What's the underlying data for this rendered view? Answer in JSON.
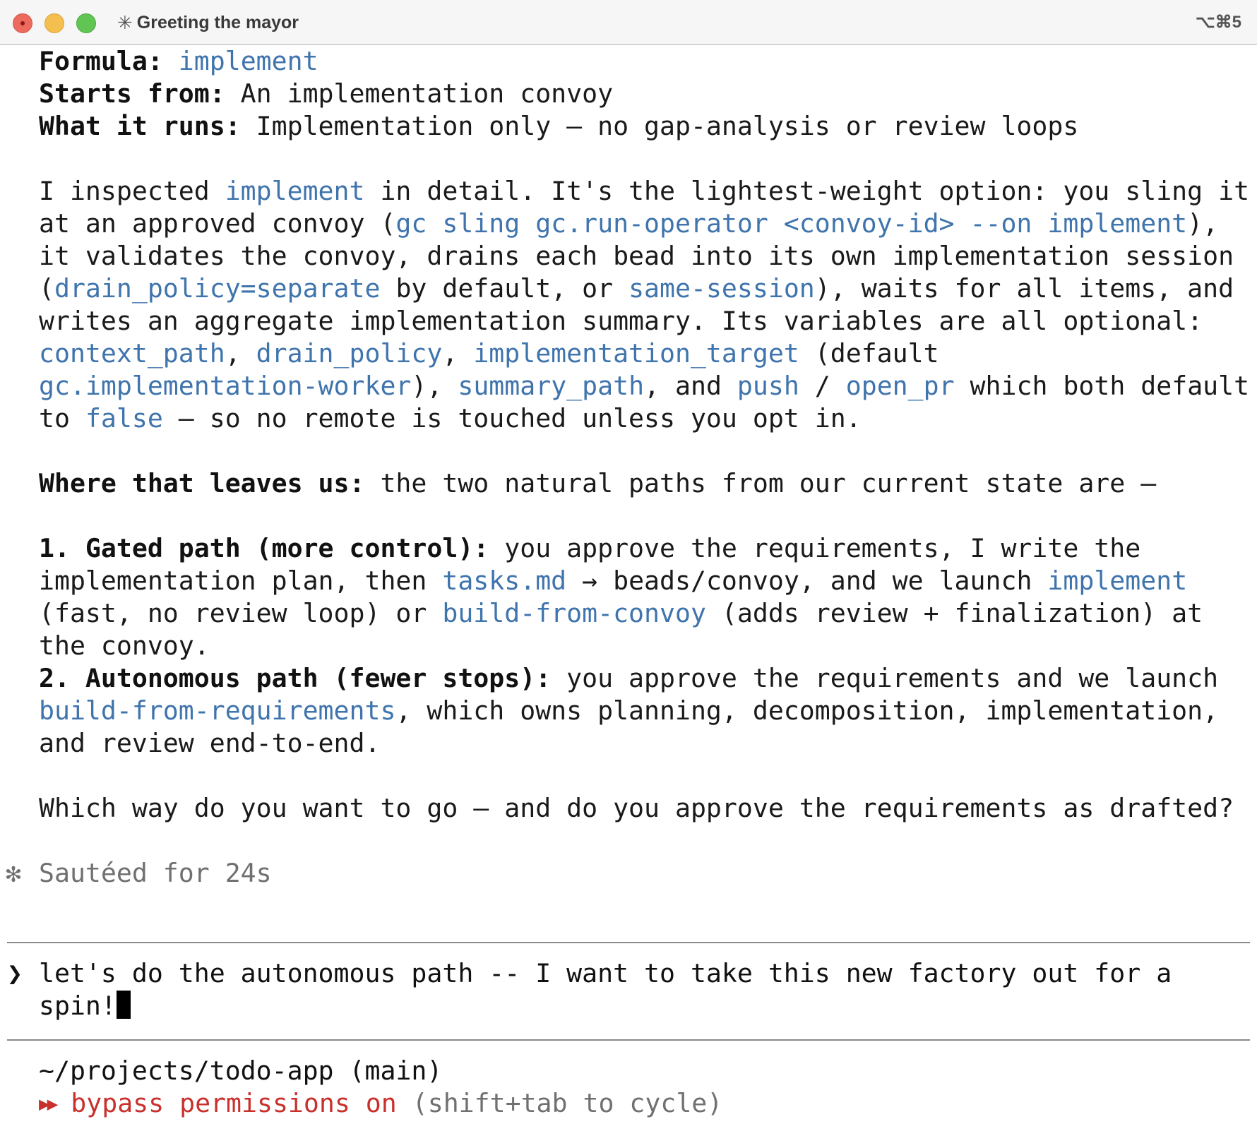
{
  "window": {
    "title": "Greeting the mayor",
    "title_icon": "✳",
    "shortcut": "⌥⌘5"
  },
  "formula": {
    "label": "Formula:",
    "value": "implement",
    "starts_label": "Starts from:",
    "starts_value": " An implementation convoy",
    "runs_label": "What it runs:",
    "runs_value": " Implementation only — no gap-analysis or review loops"
  },
  "para1": {
    "l1a": "I inspected ",
    "l1b": "implement",
    "l1c": " in detail. It's the lightest-weight option: you sling it",
    "l2a": "at an approved convoy (",
    "l2b": "gc sling gc.run-operator <convoy-id> --on implement",
    "l2c": "),",
    "l3": "it validates the convoy, drains each bead into its own implementation session",
    "l4a": "(",
    "l4b": "drain_policy=separate",
    "l4c": " by default, or ",
    "l4d": "same-session",
    "l4e": "), waits for all items, and",
    "l5": "writes an aggregate implementation summary. Its variables are all optional:",
    "l6a": "context_path",
    "l6b": ", ",
    "l6c": "drain_policy",
    "l6d": ", ",
    "l6e": "implementation_target",
    "l6f": " (default",
    "l7a": "gc.implementation-worker",
    "l7b": "), ",
    "l7c": "summary_path",
    "l7d": ", and ",
    "l7e": "push",
    "l7f": " / ",
    "l7g": "open_pr",
    "l7h": " which both default",
    "l8a": "to ",
    "l8b": "false",
    "l8c": " — so no remote is touched unless you opt in."
  },
  "leaves": {
    "label": "Where that leaves us:",
    "text": " the two natural paths from our current state are —"
  },
  "option1": {
    "label": "1. Gated path (more control):",
    "l1": " you approve the requirements, I write the",
    "l2a": "implementation plan, then ",
    "l2b": "tasks.md",
    "l2c": " → beads/convoy, and we launch ",
    "l2d": "implement",
    "l3a": "(fast, no review loop) or ",
    "l3b": "build-from-convoy",
    "l3c": " (adds review + finalization) at",
    "l4": "the convoy."
  },
  "option2": {
    "label": "2. Autonomous path (fewer stops):",
    "l1": " you approve the requirements and we launch",
    "l2a": "build-from-requirements",
    "l2b": ", which owns planning, decomposition, implementation,",
    "l3": "and review end-to-end."
  },
  "question": "Which way do you want to go — and do you approve the requirements as drafted?",
  "status": {
    "icon": "✻",
    "text": "Sautéed for 24s"
  },
  "input": {
    "caret": "❯",
    "line1": "let's do the autonomous path -- I want to take this new factory out for a",
    "line2": "spin!"
  },
  "footer": {
    "path": "~/projects/todo-app (main)",
    "mode_icon": "▶▶",
    "mode_text": " bypass permissions on",
    "mode_hint": " (shift+tab to cycle)"
  },
  "colors": {
    "link": "#3f74ad",
    "mode": "#c9302c",
    "muted": "#707070"
  }
}
